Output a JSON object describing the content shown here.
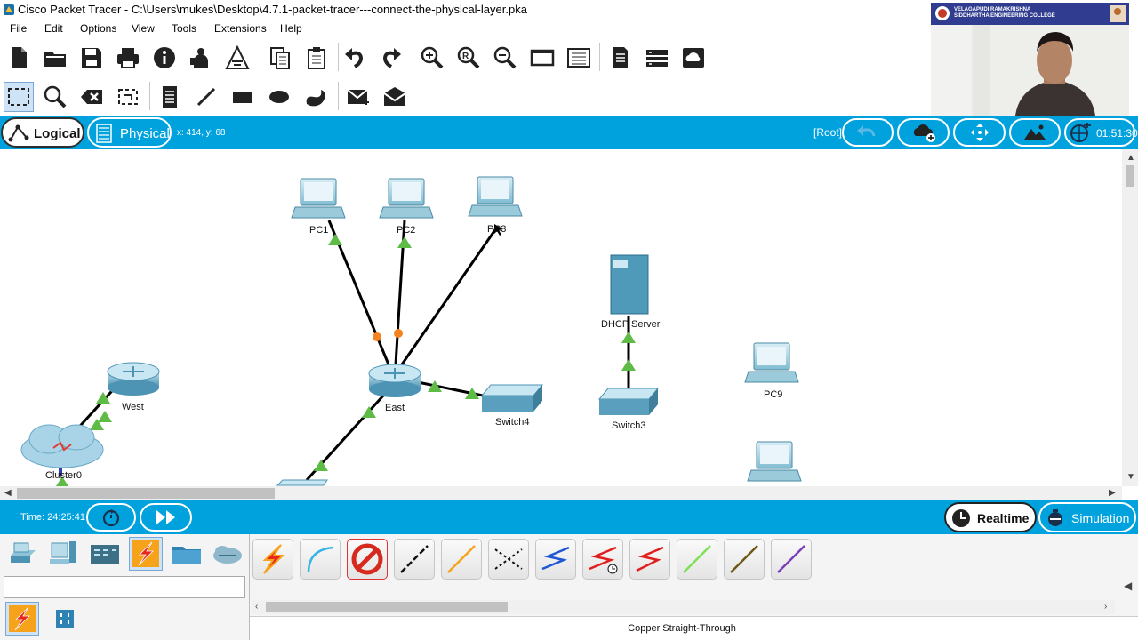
{
  "window": {
    "title": "Cisco Packet Tracer - C:\\Users\\mukes\\Desktop\\4.7.1-packet-tracer---connect-the-physical-layer.pka"
  },
  "menu": [
    "File",
    "Edit",
    "Options",
    "View",
    "Tools",
    "Extensions",
    "Help"
  ],
  "toolbar_main": [
    "new-icon",
    "open-icon",
    "save-icon",
    "print-icon",
    "info-icon",
    "network-wizard-icon",
    "ipc-icon",
    "copy-icon",
    "paste-icon",
    "undo-icon",
    "redo-icon",
    "zoom-in-icon",
    "zoom-reset-icon",
    "zoom-out-icon",
    "drawing-palette-icon",
    "custom-device-icon",
    "pdu-list-icon",
    "add-cluster-icon",
    "cloud-viewer-icon"
  ],
  "toolbar_edit": [
    "select-icon",
    "inspect-icon",
    "delete-icon",
    "resize-icon",
    "note-icon",
    "line-icon",
    "rectangle-icon",
    "ellipse-icon",
    "freeform-icon",
    "simple-pdu-icon",
    "complex-pdu-icon"
  ],
  "webcam": {
    "banner_line1": "VELAGAPUDI RAMAKRISHNA",
    "banner_line2": "SIDDHARTHA ENGINEERING COLLEGE"
  },
  "view_bar": {
    "logical_label": "Logical",
    "physical_label": "Physical",
    "coordinates": "x: 414, y: 68",
    "root_label": "[Root]",
    "clock": "01:51:30"
  },
  "devices": {
    "pc1": "PC1",
    "pc2": "PC2",
    "pc3": "PC3",
    "dhcp": "DHCP Server",
    "pc9": "PC9",
    "west": "West",
    "east": "East",
    "switch4": "Switch4",
    "switch3": "Switch3",
    "cluster": "Cluster0"
  },
  "sim_bar": {
    "time": "Time: 24:25:41",
    "realtime_label": "Realtime",
    "simulation_label": "Simulation"
  },
  "device_categories": [
    "network-devices-icon",
    "end-devices-icon",
    "components-icon",
    "connections-icon",
    "miscellaneous-icon",
    "multiuser-icon"
  ],
  "connections": [
    "automatic-connection",
    "console",
    "no-connection",
    "copper-straight-through",
    "copper-cross-over",
    "fiber",
    "phone",
    "coaxial",
    "serial-dce",
    "serial-dte",
    "octal",
    "iot-custom-cable",
    "usb"
  ],
  "status_text": "Copper Straight-Through",
  "colors": {
    "accent_blue": "#00a2de",
    "link_up": "#4caf50",
    "link_pending": "#ff8c00"
  }
}
